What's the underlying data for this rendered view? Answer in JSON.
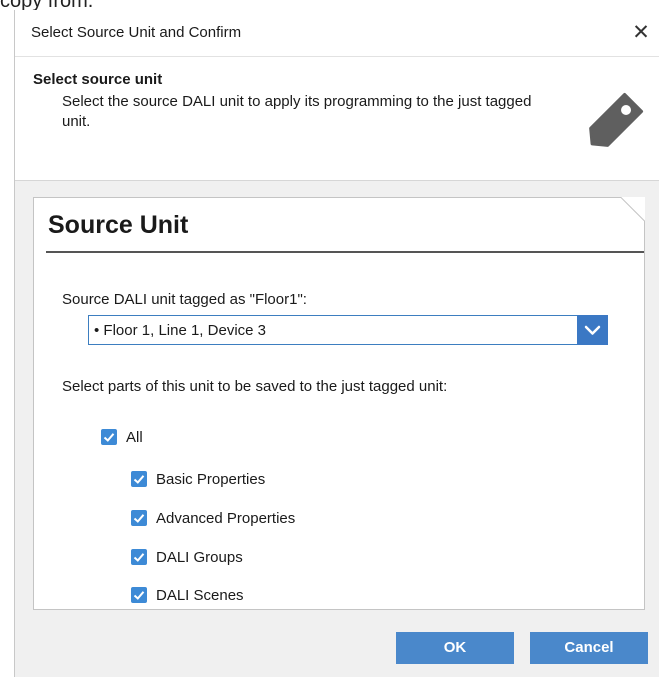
{
  "background": {
    "text": "copy from."
  },
  "dialog": {
    "title": "Select Source Unit and Confirm",
    "close_glyph": "✕"
  },
  "header": {
    "title": "Select source unit",
    "description": "Select the source DALI unit to apply its programming to the just tagged unit.",
    "icon": "tag-icon"
  },
  "card": {
    "title": "Source Unit",
    "source_label": "Source DALI unit tagged as \"Floor1\":",
    "select": {
      "value": "• Floor 1, Line 1, Device 3",
      "icon": "chevron-down-icon"
    },
    "parts_label": "Select parts of this unit to be saved to the just tagged unit:",
    "checkboxes": {
      "all": {
        "label": "All",
        "checked": true
      },
      "items": [
        {
          "label": "Basic Properties",
          "checked": true
        },
        {
          "label": "Advanced Properties",
          "checked": true
        },
        {
          "label": "DALI Groups",
          "checked": true
        },
        {
          "label": "DALI Scenes",
          "checked": true
        }
      ]
    }
  },
  "buttons": {
    "ok": "OK",
    "cancel": "Cancel"
  },
  "colors": {
    "accent": "#3b78c4",
    "checkbox": "#3d8ad6",
    "button": "#4a88cb",
    "tag_icon": "#5f5f5f"
  }
}
